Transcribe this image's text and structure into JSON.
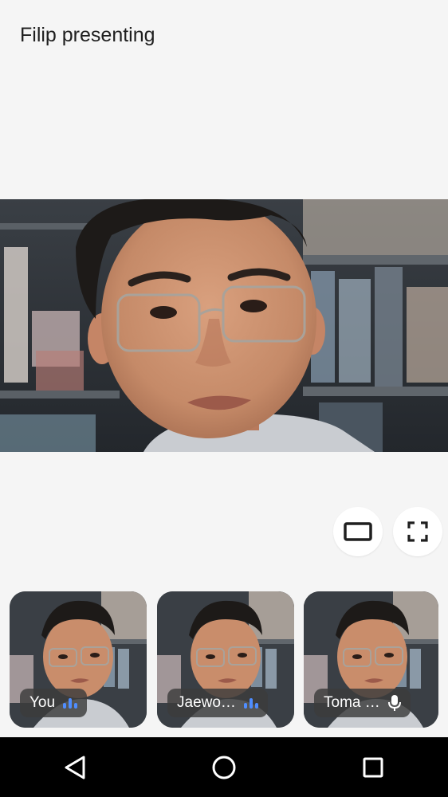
{
  "header": {
    "title": "Filip presenting"
  },
  "main_video": {
    "presenter": "Filip",
    "content": "presenter-camera-feed"
  },
  "controls": {
    "layout_icon": "layout-rectangle-icon",
    "fullscreen_icon": "fullscreen-icon"
  },
  "participants": [
    {
      "name": "You",
      "audio_icon": "speaking-indicator-icon"
    },
    {
      "name": "Jaewo…",
      "audio_icon": "speaking-indicator-icon"
    },
    {
      "name": "Toma …",
      "audio_icon": "microphone-icon"
    }
  ],
  "nav": {
    "back_icon": "back-triangle-icon",
    "home_icon": "home-circle-icon",
    "recents_icon": "recents-square-icon"
  },
  "colors": {
    "background": "#f5f5f5",
    "accent_audio": "#4f8dff",
    "chip_bg": "#3c3c3c",
    "nav_bg": "#000000"
  }
}
